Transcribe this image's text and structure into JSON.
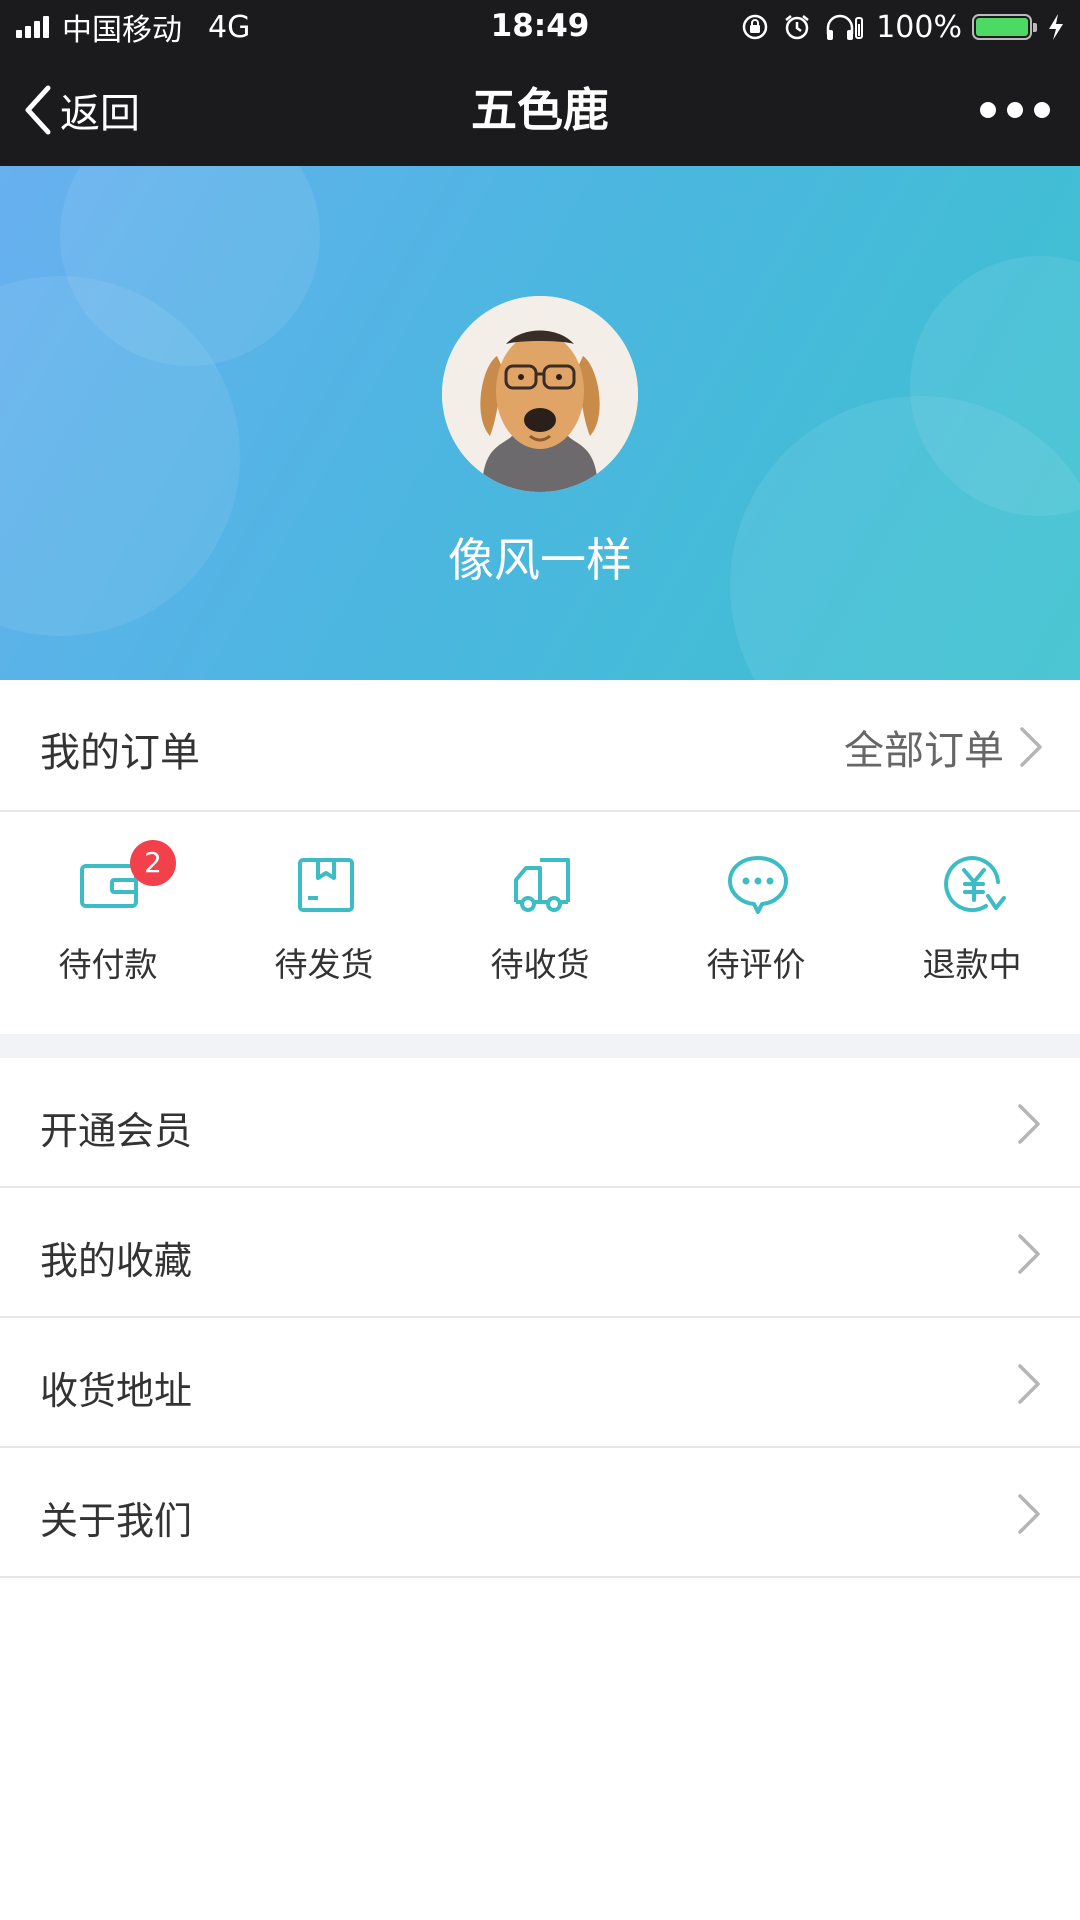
{
  "status_bar": {
    "carrier": "中国移动",
    "network": "4G",
    "time": "18:49",
    "battery": "100%"
  },
  "nav": {
    "back_label": "返回",
    "title": "五色鹿"
  },
  "profile": {
    "username": "像风一样"
  },
  "orders": {
    "title": "我的订单",
    "all_label": "全部订单",
    "statuses": [
      {
        "label": "待付款",
        "icon": "wallet-icon",
        "badge": "2"
      },
      {
        "label": "待发货",
        "icon": "package-icon"
      },
      {
        "label": "待收货",
        "icon": "truck-icon"
      },
      {
        "label": "待评价",
        "icon": "chat-bubble-icon"
      },
      {
        "label": "退款中",
        "icon": "refund-yen-icon"
      }
    ]
  },
  "menu": {
    "items": [
      {
        "label": "开通会员"
      },
      {
        "label": "我的收藏"
      },
      {
        "label": "收货地址"
      },
      {
        "label": "关于我们"
      }
    ]
  },
  "colors": {
    "accent": "#3cbcc4",
    "badge": "#f2414a",
    "bar": "#1b1b1d"
  }
}
